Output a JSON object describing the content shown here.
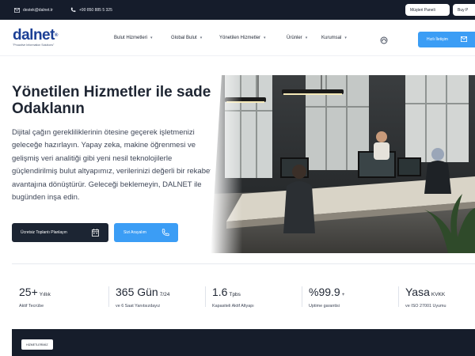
{
  "topbar": {
    "email": "destek@dalnet.tr",
    "phone": "+90 850 885 5 325",
    "customer_panel": "Müşteri Paneli",
    "buy": "Buy P"
  },
  "header": {
    "logo": {
      "text_dal": "dal",
      "text_net": "net",
      "reg": "®",
      "tagline": "\"Proactive Information Solutions\""
    },
    "nav": [
      {
        "label": "Bulut Hizmetleri"
      },
      {
        "label": "Global Bulut"
      },
      {
        "label": "Yönetilen Hizmetler"
      },
      {
        "label": "Ürünler"
      },
      {
        "label": "Kurumsal"
      }
    ],
    "contact_button": "Hızlı İletişim"
  },
  "hero": {
    "title": "Yönetilen Hizmetler ile sadece İşinize Odaklanın",
    "description": "Dijital çağın gerekliliklerinin ötesine geçerek işletmenizi geleceğe hazırlayın. Yapay zeka, makine öğrenmesi ve gelişmiş veri analitiği gibi yeni nesil teknolojilerle güçlendirilmiş bulut altyapımız, verilerinizi değerli bir rekabet avantajına dönüştürür. Geleceği beklemeyin, DALNET ile bugünden inşa edin.",
    "button_primary": "Ücretsiz Toplantı Planlayın",
    "button_secondary": "Sizi Arayalım"
  },
  "stats": [
    {
      "value": "25+",
      "suffix": "Yıllık",
      "label": "Aktif Tecrübe"
    },
    {
      "value": "365 Gün",
      "suffix": "7/24",
      "label": "ve 6 Saat Yanıtsızdayız"
    },
    {
      "value": "1.6",
      "suffix": "Tpbs",
      "label": "Kapasiteli Aktif Altyapı"
    },
    {
      "value": "%99.9",
      "suffix": "+",
      "label": "Uptime garantisi"
    },
    {
      "value": "Yasa",
      "suffix": "KVKK",
      "label": "ve ISO 27001 Uyumu"
    }
  ],
  "bottom": {
    "chip": "HİZMETLERİMİZ"
  },
  "colors": {
    "brand": "#1b3f95",
    "accent": "#3b9df5",
    "dark": "#151c2b"
  }
}
